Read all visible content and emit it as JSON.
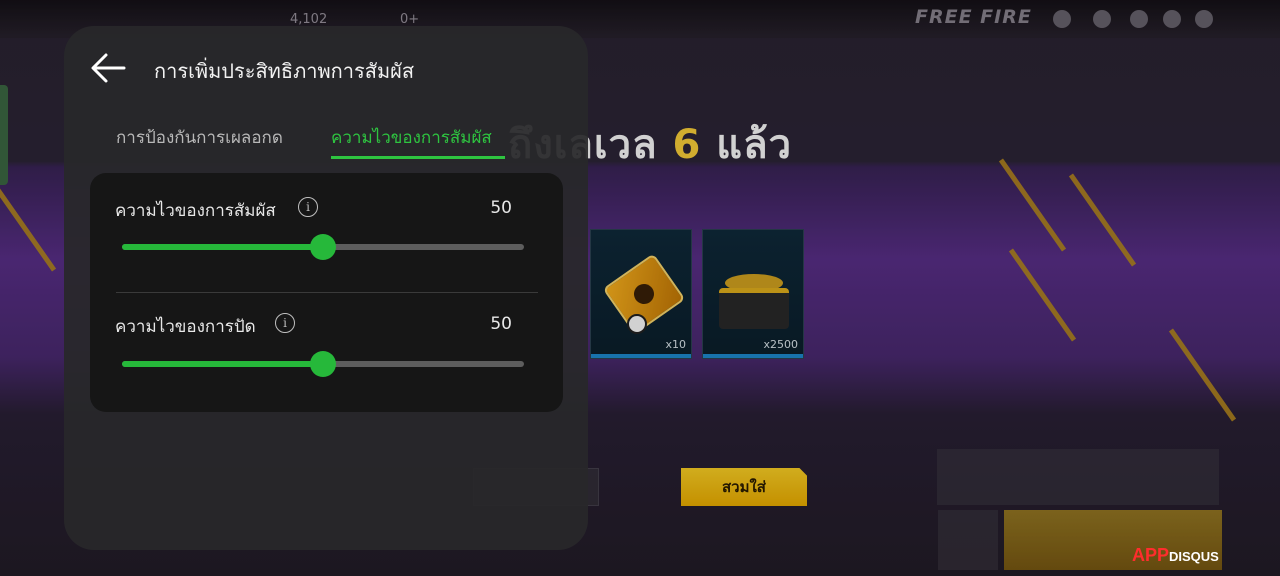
{
  "background": {
    "brand": "FREE FIRE",
    "top_stats": [
      "4,102",
      "0+"
    ],
    "level_prefix": "ถึงเลเวล",
    "level_number": "6",
    "level_suffix": "แล้ว",
    "rewards": [
      {
        "name": "ticket-reward",
        "qty": "x10"
      },
      {
        "name": "gold-chest-reward",
        "qty": "x2500"
      }
    ],
    "equip_button": "สวมใส่",
    "watermark": {
      "app": "APP",
      "dis": "DISQUS"
    }
  },
  "panel": {
    "title": "การเพิ่มประสิทธิภาพการสัมผัส",
    "tabs": [
      {
        "label": "การป้องกันการเผลอกด",
        "active": false
      },
      {
        "label": "ความไวของการสัมผัส",
        "active": true
      }
    ],
    "settings": [
      {
        "label": "ความไวของการสัมผัส",
        "value": "50",
        "fraction": 0.5
      },
      {
        "label": "ความไวของการปัด",
        "value": "50",
        "fraction": 0.5
      }
    ]
  },
  "colors": {
    "accent": "#26b83a",
    "tab_active": "#2ec440",
    "level_number": "#ffd43a",
    "equip_button": "#ffd325"
  }
}
